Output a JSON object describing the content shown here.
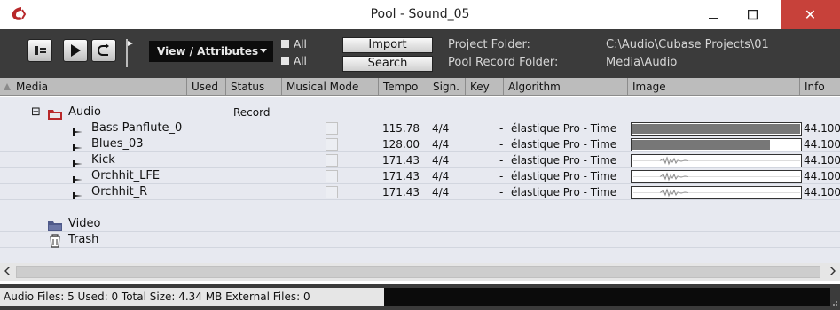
{
  "window": {
    "title": "Pool - Sound_05",
    "close_label": "✕"
  },
  "toolbar": {
    "view_attributes_label": "View / Attributes",
    "expand_all_label": "All",
    "collapse_all_label": "All",
    "import_label": "Import",
    "search_label": "Search",
    "project_folder_label": "Project Folder:",
    "project_folder_value": "C:\\Audio\\Cubase Projects\\01",
    "pool_record_folder_label": "Pool Record Folder:",
    "pool_record_folder_value": "Media\\Audio"
  },
  "columns": {
    "media": "Media",
    "used": "Used",
    "status": "Status",
    "musical_mode": "Musical Mode",
    "tempo": "Tempo",
    "signature": "Sign.",
    "key": "Key",
    "algorithm": "Algorithm",
    "image": "Image",
    "info": "Info"
  },
  "folders": {
    "audio": {
      "label": "Audio",
      "status": "Record",
      "expand_symbol": "⊟"
    },
    "video": {
      "label": "Video"
    },
    "trash": {
      "label": "Trash"
    }
  },
  "clips": [
    {
      "name": "Bass Panflute_0",
      "tempo": "115.78",
      "signature": "4/4",
      "key": "-",
      "algorithm": "élastique Pro - Time",
      "info": "44.100",
      "wave_fill": 1.0
    },
    {
      "name": "Blues_03",
      "tempo": "128.00",
      "signature": "4/4",
      "key": "-",
      "algorithm": "élastique Pro - Time",
      "info": "44.100",
      "wave_fill": 0.82
    },
    {
      "name": "Kick",
      "tempo": "171.43",
      "signature": "4/4",
      "key": "-",
      "algorithm": "élastique Pro - Time",
      "info": "44.100",
      "wave_fill": 0.0
    },
    {
      "name": "Orchhit_LFE",
      "tempo": "171.43",
      "signature": "4/4",
      "key": "-",
      "algorithm": "élastique Pro - Time",
      "info": "44.100",
      "wave_fill": 0.0
    },
    {
      "name": "Orchhit_R",
      "tempo": "171.43",
      "signature": "4/4",
      "key": "-",
      "algorithm": "élastique Pro - Time",
      "info": "44.100",
      "wave_fill": 0.0
    }
  ],
  "status": {
    "summary": "Audio Files: 5   Used: 0   Total Size: 4.34 MB   External Files: 0"
  },
  "colors": {
    "accent_red": "#b8282a",
    "close_red": "#c7413a",
    "toolbar_dark": "#3b3b3b",
    "list_bg": "#e7e9f0"
  }
}
